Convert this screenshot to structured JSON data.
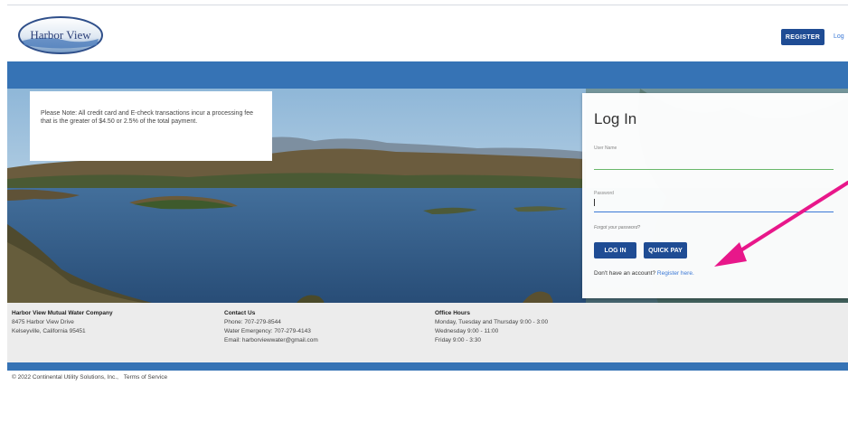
{
  "header": {
    "logo_text": "Harbor View",
    "register_label": "REGISTER",
    "login_link_label": "Log"
  },
  "notice": {
    "text": "Please Note: All credit card and E-check transactions incur a processing fee that is the greater of $4.50 or 2.5% of the total payment."
  },
  "login": {
    "title": "Log In",
    "username_label": "User Name",
    "password_label": "Password",
    "forgot_label": "Forgot your password?",
    "login_button": "LOG IN",
    "quickpay_button": "QUICK PAY",
    "no_account_text": "Don't have an account?",
    "register_link": "Register here."
  },
  "footer": {
    "company": {
      "name": "Harbor View Mutual Water Company",
      "address1": "8475 Harbor View Drive",
      "address2": "Kelseyville, California 95451"
    },
    "contact": {
      "heading": "Contact Us",
      "phone": "Phone: 707-279-8544",
      "emergency": "Water Emergency: 707-279-4143",
      "email": "Email: harborviewwater@gmail.com"
    },
    "hours": {
      "heading": "Office Hours",
      "line1": "Monday, Tuesday and Thursday 9:00 - 3:00",
      "line2": "Wednesday 9:00 - 11:00",
      "line3": "Friday 9:00 - 3:30"
    }
  },
  "copyright": {
    "text": "© 2022 Continental Utility Solutions, Inc.,",
    "terms": "Terms of Service"
  },
  "colors": {
    "brand_blue": "#1f4c94",
    "band_blue": "#3673b5",
    "annotation_arrow": "#e8178a"
  }
}
